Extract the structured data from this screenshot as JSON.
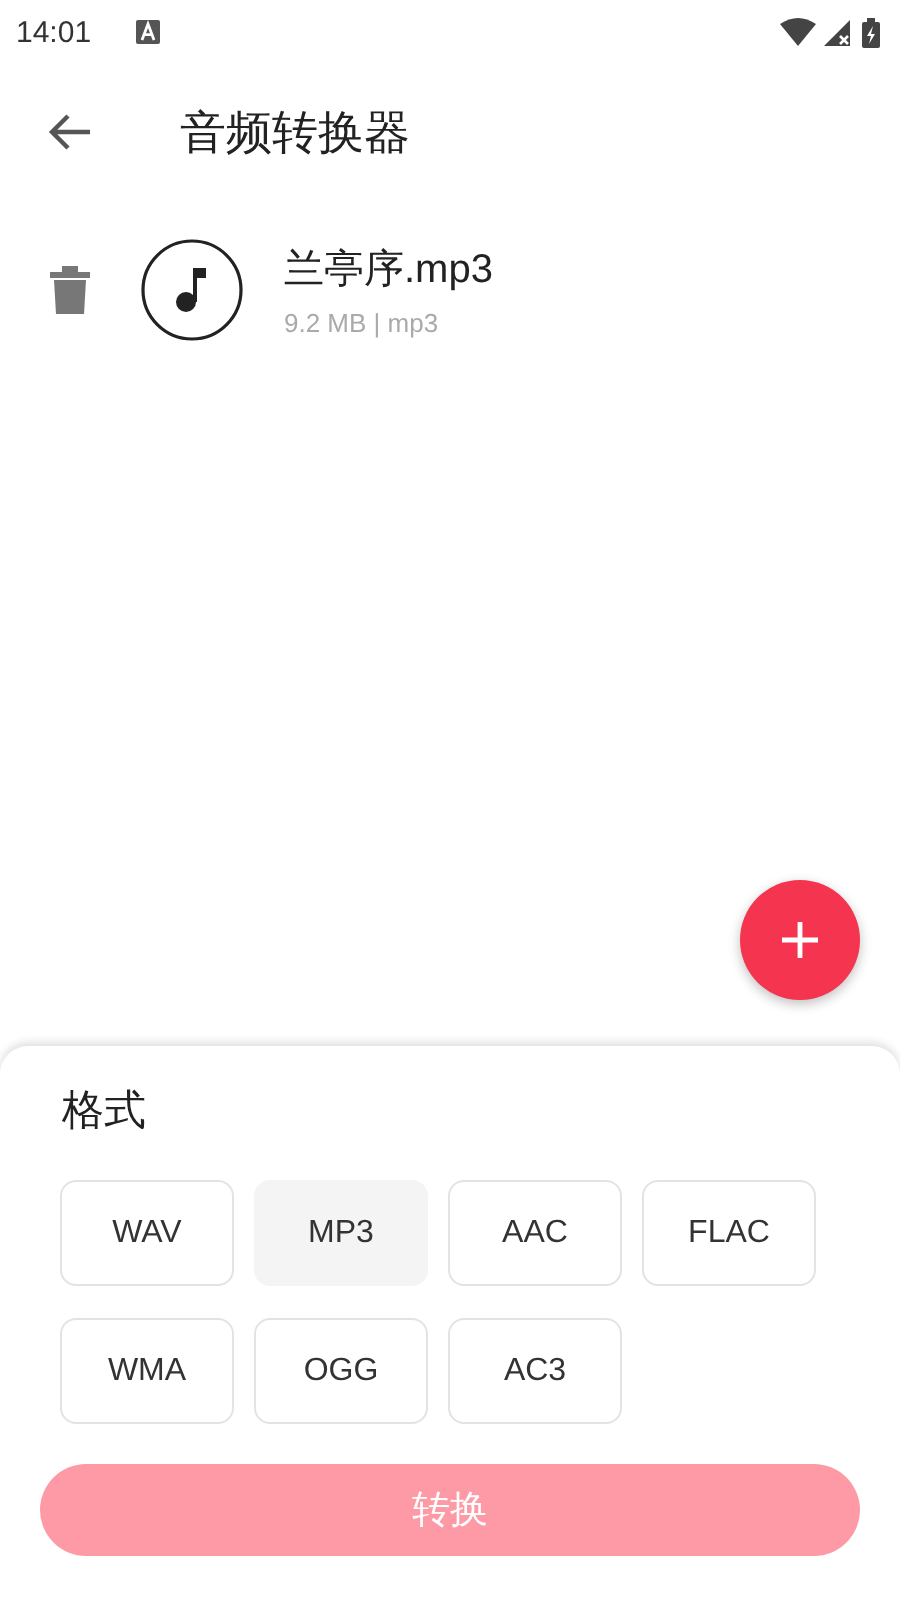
{
  "status_bar": {
    "time": "14:01"
  },
  "toolbar": {
    "title": "音频转换器"
  },
  "files": [
    {
      "name": "兰亭序.mp3",
      "details": "9.2 MB | mp3"
    }
  ],
  "sheet": {
    "title": "格式",
    "formats": [
      {
        "label": "WAV",
        "disabled": false
      },
      {
        "label": "MP3",
        "disabled": true
      },
      {
        "label": "AAC",
        "disabled": false
      },
      {
        "label": "FLAC",
        "disabled": false
      },
      {
        "label": "WMA",
        "disabled": false
      },
      {
        "label": "OGG",
        "disabled": false
      },
      {
        "label": "AC3",
        "disabled": false
      }
    ],
    "convert_button": {
      "label": "转换",
      "disabled": true
    }
  }
}
